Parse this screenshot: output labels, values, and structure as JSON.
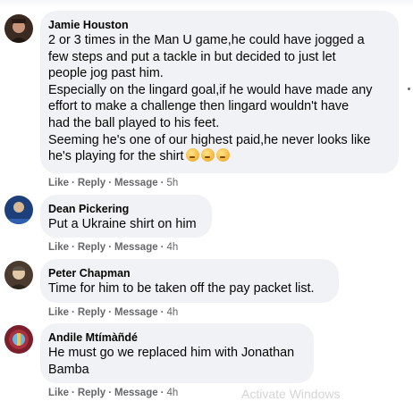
{
  "top_fragment": "· ·",
  "comments": [
    {
      "author": "Jamie Houston",
      "text": "2 or 3 times in the Man U game,he could have jogged a\nfew steps and put a tackle in but decided to just let\npeople jog past him.\nEspecially on the lingard goal,if he would have made any\neffort to make a challenge then lingard wouldn't have\nhad the ball played to his feet.\nSeeming he's one of our highest paid,he never looks like\nhe's playing for the shirt",
      "emoji_count": 3,
      "emoji_icon": "thinking-face-emoji",
      "like": "Like",
      "reply": "Reply",
      "message": "Message",
      "time": "5h",
      "avatar_color": "#3b2a22"
    },
    {
      "author": "Dean Pickering",
      "text": "Put a Ukraine shirt on him",
      "like": "Like",
      "reply": "Reply",
      "message": "Message",
      "time": "4h",
      "avatar_color": "#1d3f7a"
    },
    {
      "author": "Peter Chapman",
      "text": "Time for him to be taken off the pay packet list.",
      "like": "Like",
      "reply": "Reply",
      "message": "Message",
      "time": "4h",
      "avatar_color": "#4a3b2e"
    },
    {
      "author": "Andile Mtímàñdé",
      "text": "He must go we replaced him with Jonathan\nBamba",
      "like": "Like",
      "reply": "Reply",
      "message": "Message",
      "time": "4h",
      "avatar_color": "#7a1f2b"
    }
  ],
  "separator": "·",
  "watermark": "Activate Windows"
}
